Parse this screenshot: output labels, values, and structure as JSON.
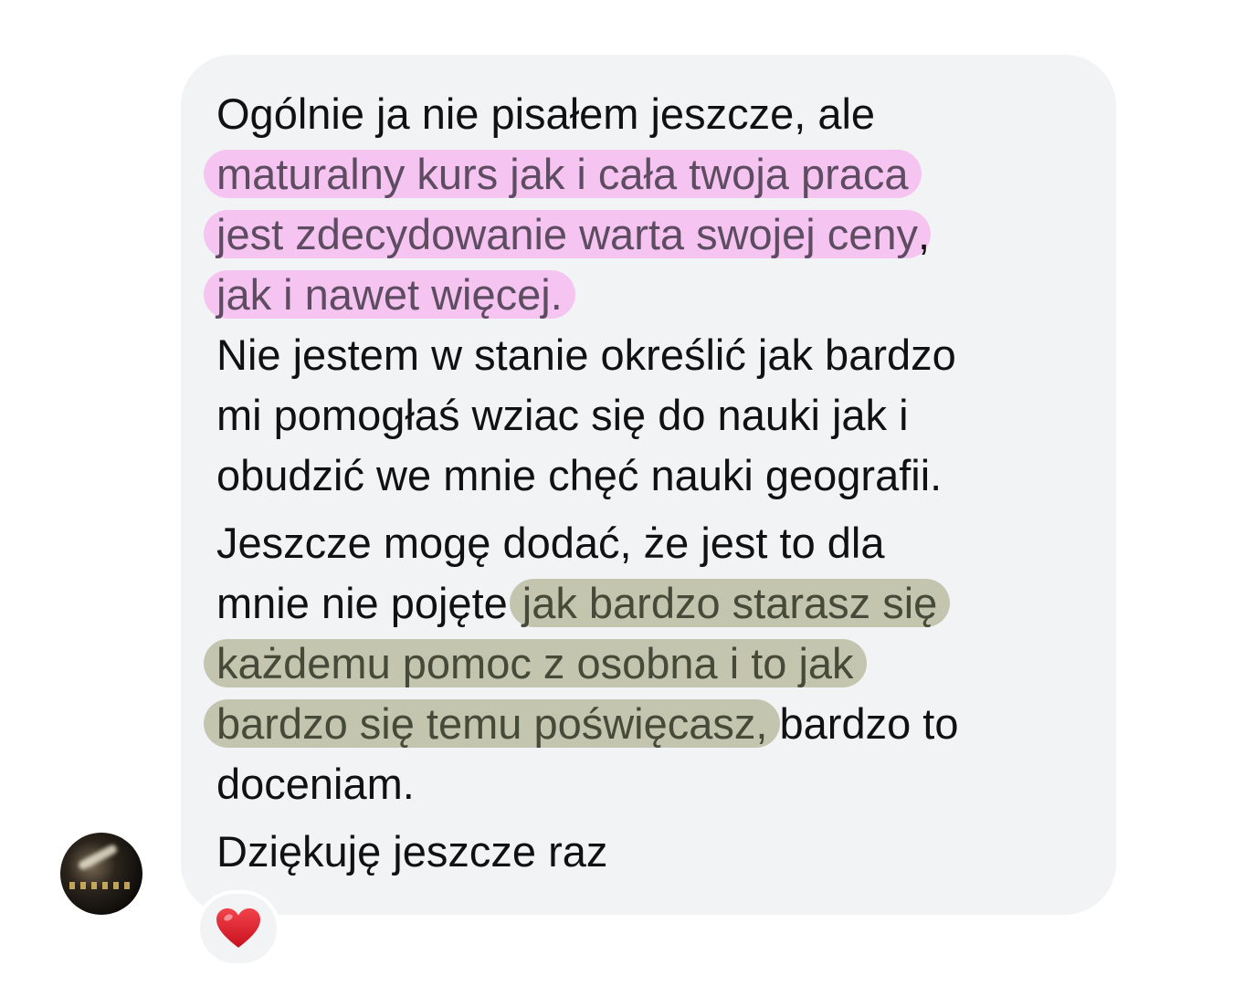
{
  "message": {
    "paragraph1": {
      "line1": "Ogólnie ja nie pisałem jeszcze, ale",
      "line2_highlight": "maturalny kurs jak i cała twoja praca",
      "line3_highlight": "jest zdecydowanie warta swojej ceny",
      "line3_after": ",",
      "line4_highlight": "jak i nawet więcej."
    },
    "paragraph2": {
      "line1": "Nie jestem w stanie określić jak bardzo",
      "line2": "mi pomogłaś wziac się do nauki jak i",
      "line3": "obudzić we mnie chęć nauki geografii."
    },
    "paragraph3": {
      "line1": "Jeszcze mogę dodać, że jest to dla",
      "line2_before": "mnie nie pojęte",
      "line2_highlight": "jak bardzo starasz się",
      "line3_highlight": "każdemu pomoc z osobna i to jak",
      "line4_highlight": "bardzo się temu poświęcasz,",
      "line4_after": " bardzo to",
      "line5": "doceniam."
    },
    "paragraph4": {
      "line1": "Dziękuję jeszcze raz"
    }
  },
  "reaction": {
    "icon": "red-heart-icon",
    "color": "#e0202b"
  },
  "colors": {
    "bubble": "#f2f3f5",
    "highlight_pink": "#f5c4f1",
    "highlight_olive": "#c3c5ae"
  }
}
